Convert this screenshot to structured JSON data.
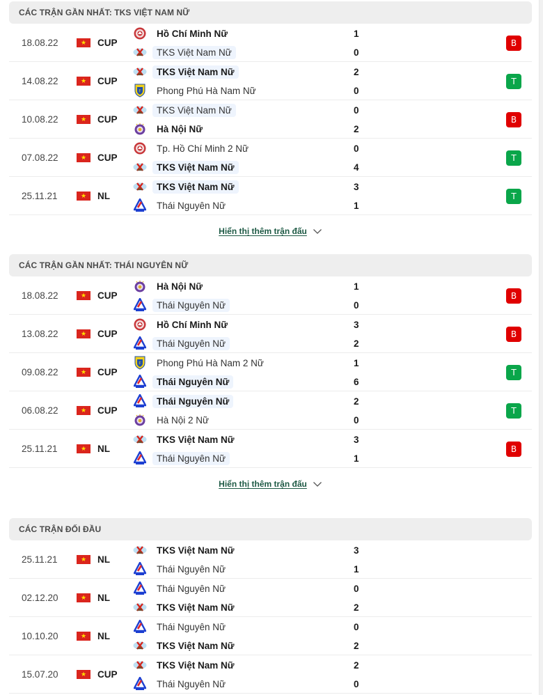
{
  "colors": {
    "loss": "#e00000",
    "win": "#0aa64a",
    "link": "#1e5a45",
    "header_bg": "#eeeeee",
    "highlight_bg": "#eef4fd"
  },
  "sections": [
    {
      "title": "CÁC TRẬN GẦN NHẤT: TKS VIỆT NAM NỮ",
      "show_more": "Hiển thị thêm trận đấu",
      "matches": [
        {
          "date": "18.08.22",
          "flag": "vietnam-flag",
          "comp": "CUP",
          "home": {
            "name": "Hồ Chí Minh Nữ",
            "logo": "hcm",
            "bold": true,
            "hl": false,
            "score": "1"
          },
          "away": {
            "name": "TKS Việt Nam Nữ",
            "logo": "tks",
            "bold": false,
            "hl": true,
            "score": "0"
          },
          "result": "B"
        },
        {
          "date": "14.08.22",
          "flag": "vietnam-flag",
          "comp": "CUP",
          "home": {
            "name": "TKS Việt Nam Nữ",
            "logo": "tks",
            "bold": true,
            "hl": true,
            "score": "2"
          },
          "away": {
            "name": "Phong Phú Hà Nam Nữ",
            "logo": "hanam",
            "bold": false,
            "hl": false,
            "score": "0"
          },
          "result": "T"
        },
        {
          "date": "10.08.22",
          "flag": "vietnam-flag",
          "comp": "CUP",
          "home": {
            "name": "TKS Việt Nam Nữ",
            "logo": "tks",
            "bold": false,
            "hl": true,
            "score": "0"
          },
          "away": {
            "name": "Hà Nội Nữ",
            "logo": "hanoi",
            "bold": true,
            "hl": false,
            "score": "2"
          },
          "result": "B"
        },
        {
          "date": "07.08.22",
          "flag": "vietnam-flag",
          "comp": "CUP",
          "home": {
            "name": "Tp. Hồ Chí Minh 2 Nữ",
            "logo": "hcm",
            "bold": false,
            "hl": false,
            "score": "0"
          },
          "away": {
            "name": "TKS Việt Nam Nữ",
            "logo": "tks",
            "bold": true,
            "hl": true,
            "score": "4"
          },
          "result": "T"
        },
        {
          "date": "25.11.21",
          "flag": "vietnam-flag",
          "comp": "NL",
          "home": {
            "name": "TKS Việt Nam Nữ",
            "logo": "tks",
            "bold": true,
            "hl": true,
            "score": "3"
          },
          "away": {
            "name": "Thái Nguyên Nữ",
            "logo": "thainguyen",
            "bold": false,
            "hl": false,
            "score": "1"
          },
          "result": "T"
        }
      ]
    },
    {
      "title": "CÁC TRẬN GẦN NHẤT: THÁI NGUYÊN NỮ",
      "show_more": "Hiển thị thêm trận đấu",
      "matches": [
        {
          "date": "18.08.22",
          "flag": "vietnam-flag",
          "comp": "CUP",
          "home": {
            "name": "Hà Nội Nữ",
            "logo": "hanoi",
            "bold": true,
            "hl": false,
            "score": "1"
          },
          "away": {
            "name": "Thái Nguyên Nữ",
            "logo": "thainguyen",
            "bold": false,
            "hl": true,
            "score": "0"
          },
          "result": "B"
        },
        {
          "date": "13.08.22",
          "flag": "vietnam-flag",
          "comp": "CUP",
          "home": {
            "name": "Hồ Chí Minh Nữ",
            "logo": "hcm",
            "bold": true,
            "hl": false,
            "score": "3"
          },
          "away": {
            "name": "Thái Nguyên Nữ",
            "logo": "thainguyen",
            "bold": false,
            "hl": true,
            "score": "2"
          },
          "result": "B"
        },
        {
          "date": "09.08.22",
          "flag": "vietnam-flag",
          "comp": "CUP",
          "home": {
            "name": "Phong Phú Hà Nam 2 Nữ",
            "logo": "hanam",
            "bold": false,
            "hl": false,
            "score": "1"
          },
          "away": {
            "name": "Thái Nguyên Nữ",
            "logo": "thainguyen",
            "bold": true,
            "hl": true,
            "score": "6"
          },
          "result": "T"
        },
        {
          "date": "06.08.22",
          "flag": "vietnam-flag",
          "comp": "CUP",
          "home": {
            "name": "Thái Nguyên Nữ",
            "logo": "thainguyen",
            "bold": true,
            "hl": true,
            "score": "2"
          },
          "away": {
            "name": "Hà Nội 2 Nữ",
            "logo": "hanoi",
            "bold": false,
            "hl": false,
            "score": "0"
          },
          "result": "T"
        },
        {
          "date": "25.11.21",
          "flag": "vietnam-flag",
          "comp": "NL",
          "home": {
            "name": "TKS Việt Nam Nữ",
            "logo": "tks",
            "bold": true,
            "hl": false,
            "score": "3"
          },
          "away": {
            "name": "Thái Nguyên Nữ",
            "logo": "thainguyen",
            "bold": false,
            "hl": true,
            "score": "1"
          },
          "result": "B"
        }
      ]
    },
    {
      "title": "CÁC TRẬN ĐỐI ĐẦU",
      "show_more": null,
      "matches": [
        {
          "date": "25.11.21",
          "flag": "vietnam-flag",
          "comp": "NL",
          "home": {
            "name": "TKS Việt Nam Nữ",
            "logo": "tks",
            "bold": true,
            "hl": false,
            "score": "3"
          },
          "away": {
            "name": "Thái Nguyên Nữ",
            "logo": "thainguyen",
            "bold": false,
            "hl": false,
            "score": "1"
          },
          "result": null
        },
        {
          "date": "02.12.20",
          "flag": "vietnam-flag",
          "comp": "NL",
          "home": {
            "name": "Thái Nguyên Nữ",
            "logo": "thainguyen",
            "bold": false,
            "hl": false,
            "score": "0"
          },
          "away": {
            "name": "TKS Việt Nam Nữ",
            "logo": "tks",
            "bold": true,
            "hl": false,
            "score": "2"
          },
          "result": null
        },
        {
          "date": "10.10.20",
          "flag": "vietnam-flag",
          "comp": "NL",
          "home": {
            "name": "Thái Nguyên Nữ",
            "logo": "thainguyen",
            "bold": false,
            "hl": false,
            "score": "0"
          },
          "away": {
            "name": "TKS Việt Nam Nữ",
            "logo": "tks",
            "bold": true,
            "hl": false,
            "score": "2"
          },
          "result": null
        },
        {
          "date": "15.07.20",
          "flag": "vietnam-flag",
          "comp": "CUP",
          "home": {
            "name": "TKS Việt Nam Nữ",
            "logo": "tks",
            "bold": true,
            "hl": false,
            "score": "2"
          },
          "away": {
            "name": "Thái Nguyên Nữ",
            "logo": "thainguyen",
            "bold": false,
            "hl": false,
            "score": "0"
          },
          "result": null
        }
      ]
    }
  ]
}
